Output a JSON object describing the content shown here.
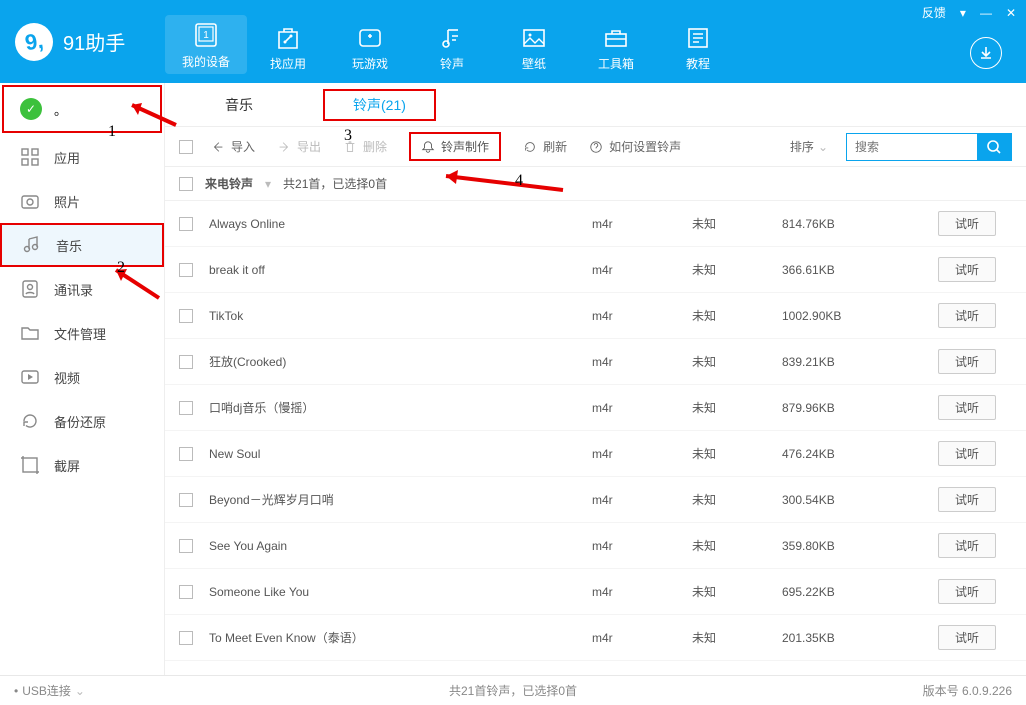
{
  "header": {
    "app_name": "91助手",
    "feedback": "反馈",
    "nav": [
      {
        "label": "我的设备"
      },
      {
        "label": "找应用"
      },
      {
        "label": "玩游戏"
      },
      {
        "label": "铃声"
      },
      {
        "label": "壁纸"
      },
      {
        "label": "工具箱"
      },
      {
        "label": "教程"
      }
    ]
  },
  "sidebar": {
    "device_label": "。",
    "items": [
      {
        "label": "应用"
      },
      {
        "label": "照片"
      },
      {
        "label": "音乐"
      },
      {
        "label": "通讯录"
      },
      {
        "label": "文件管理"
      },
      {
        "label": "视频"
      },
      {
        "label": "备份还原"
      },
      {
        "label": "截屏"
      }
    ]
  },
  "tabs": {
    "music": "音乐",
    "ringtone": "铃声(21)"
  },
  "toolbar": {
    "import": "导入",
    "export": "导出",
    "delete": "删除",
    "make": "铃声制作",
    "refresh": "刷新",
    "howto": "如何设置铃声",
    "sort": "排序",
    "search_placeholder": "搜索"
  },
  "section": {
    "title": "来电铃声",
    "info": "共21首，已选择0首"
  },
  "columns": {
    "listen": "试听"
  },
  "rows": [
    {
      "name": "Always Online",
      "fmt": "m4r",
      "col2": "未知",
      "size": "814.76KB"
    },
    {
      "name": "break it off",
      "fmt": "m4r",
      "col2": "未知",
      "size": "366.61KB"
    },
    {
      "name": "TikTok",
      "fmt": "m4r",
      "col2": "未知",
      "size": "1002.90KB"
    },
    {
      "name": "狂放(Crooked)",
      "fmt": "m4r",
      "col2": "未知",
      "size": "839.21KB"
    },
    {
      "name": "口哨dj音乐（慢摇）",
      "fmt": "m4r",
      "col2": "未知",
      "size": "879.96KB"
    },
    {
      "name": "New Soul",
      "fmt": "m4r",
      "col2": "未知",
      "size": "476.24KB"
    },
    {
      "name": "Beyond－光辉岁月口哨",
      "fmt": "m4r",
      "col2": "未知",
      "size": "300.54KB"
    },
    {
      "name": "See You Again",
      "fmt": "m4r",
      "col2": "未知",
      "size": "359.80KB"
    },
    {
      "name": "Someone Like You",
      "fmt": "m4r",
      "col2": "未知",
      "size": "695.22KB"
    },
    {
      "name": "To Meet Even Know（泰语）",
      "fmt": "m4r",
      "col2": "未知",
      "size": "201.35KB"
    }
  ],
  "statusbar": {
    "usb": "USB连接",
    "center": "共21首铃声，已选择0首",
    "version": "版本号 6.0.9.226"
  },
  "annotations": {
    "n1": "1",
    "n2": "2",
    "n3": "3",
    "n4": "4"
  }
}
